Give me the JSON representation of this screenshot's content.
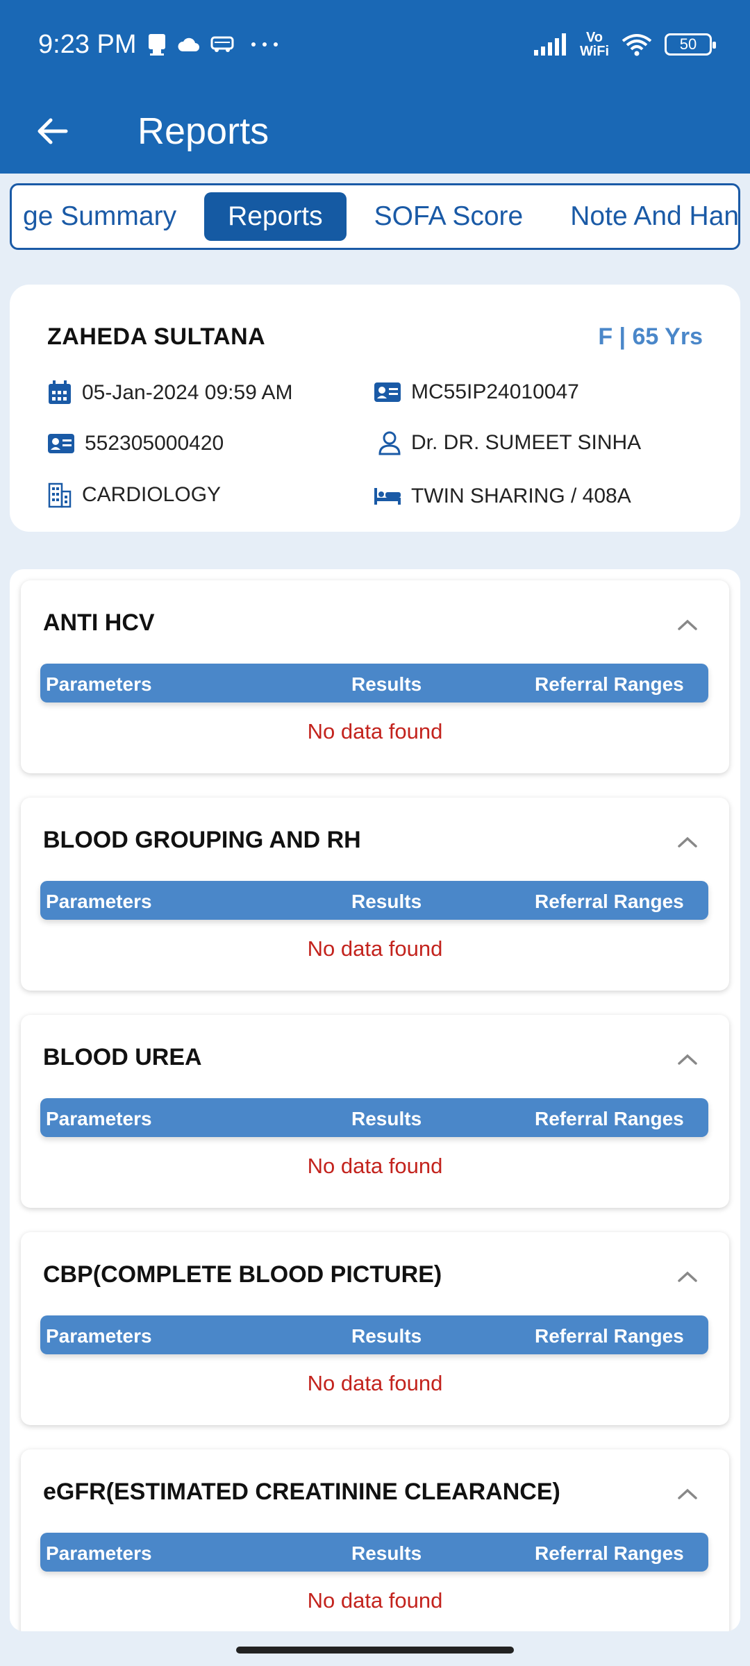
{
  "status_bar": {
    "time": "9:23 PM",
    "icons": [
      "notification-icon",
      "cloud-icon",
      "bus-icon",
      "more-dots-icon"
    ],
    "vowifi_top": "Vo",
    "vowifi_bottom": "WiFi",
    "battery": "50"
  },
  "app_bar": {
    "title": "Reports"
  },
  "tabs": [
    {
      "label": "ge Summary",
      "active": false
    },
    {
      "label": "Reports",
      "active": true
    },
    {
      "label": "SOFA Score",
      "active": false
    },
    {
      "label": "Note And Hand",
      "active": false
    }
  ],
  "patient": {
    "name": "ZAHEDA SULTANA",
    "gender_age": "F | 65 Yrs",
    "admit_datetime": "05-Jan-2024 09:59 AM",
    "ip_number": "MC55IP24010047",
    "uhid": "552305000420",
    "doctor": "Dr. DR. SUMEET SINHA",
    "department": "CARDIOLOGY",
    "bed": "TWIN SHARING / 408A"
  },
  "table_headers": {
    "parameters": "Parameters",
    "results": "Results",
    "ranges": "Referral Ranges"
  },
  "empty_text": "No data found",
  "reports": [
    {
      "title": "ANTI HCV"
    },
    {
      "title": "BLOOD GROUPING AND RH"
    },
    {
      "title": "BLOOD UREA"
    },
    {
      "title": "CBP(COMPLETE BLOOD PICTURE)"
    },
    {
      "title": "eGFR(ESTIMATED CREATININE CLEARANCE)"
    }
  ],
  "colors": {
    "primary": "#1a68b5",
    "accent": "#4a87c9",
    "empty_red": "#c3231d"
  }
}
